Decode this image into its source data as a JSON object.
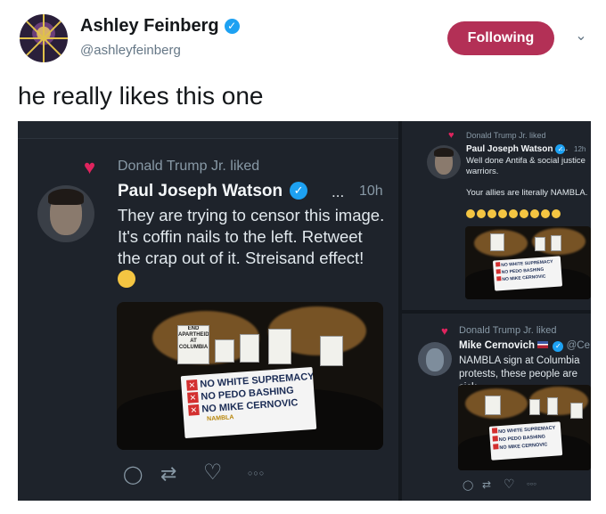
{
  "tweet": {
    "author_name": "Ashley Feinberg",
    "author_handle": "@ashleyfeinberg",
    "follow_label": "Following",
    "verified_mark": "✓",
    "caret": "⌄",
    "text": "he really likes this one"
  },
  "colors": {
    "follow_button": "#b33056",
    "like_heart": "#e0245e",
    "verified": "#1da1f2",
    "dark_bg": "#1e232b"
  },
  "screenshot_left": {
    "liked_by": "Donald Trump Jr. liked",
    "name": "Paul Joseph Watson",
    "dots": "...",
    "time": "10h",
    "body": "They are trying to censor this image. It's coffin nails to the left. Retweet the crap out of it. Streisand effect!",
    "banner_lines": [
      "NO WHITE SUPREMACY",
      "NO PEDO BASHING",
      "NO MIKE CERNOVIC"
    ],
    "banner_footer": "NAMBLA",
    "sign_left": "END APARTHEID AT COLUMBIA",
    "actions": {
      "reply_icon": "◯",
      "retweet_icon": "⇄",
      "like_icon": "♡",
      "more_icon": "○○○"
    }
  },
  "screenshot_top_right": {
    "liked_by": "Donald Trump Jr. liked",
    "name": "Paul Joseph Watson",
    "dots": "...",
    "time": "12h",
    "body": "Well done Antifa & social justice warriors.",
    "reply": "Your allies are literally NAMBLA.",
    "banner_lines": [
      "NO WHITE SUPREMACY",
      "NO PEDO BASHING",
      "NO MIKE CERNOVIC"
    ]
  },
  "screenshot_bottom_right": {
    "liked_by": "Donald Trump Jr. liked",
    "name": "Mike Cernovich",
    "handle": "@Ce...",
    "body": "NAMBLA sign at Columbia protests, these people are sick",
    "banner_lines": [
      "NO WHITE SUPREMACY",
      "NO PEDO BASHING",
      "NO MIKE CERNOVIC"
    ],
    "actions": {
      "reply_icon": "◯",
      "retweet_icon": "⇄",
      "like_icon": "♡",
      "more_icon": "○○○"
    }
  }
}
